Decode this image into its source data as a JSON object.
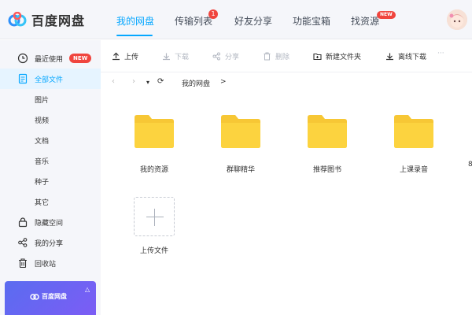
{
  "app": {
    "name": "百度网盘"
  },
  "nav": {
    "tabs": [
      {
        "label": "我的网盘",
        "active": true
      },
      {
        "label": "传输列表",
        "badge": "1"
      },
      {
        "label": "好友分享"
      },
      {
        "label": "功能宝箱"
      },
      {
        "label": "找资源",
        "badge": "NEW"
      }
    ]
  },
  "sidebar": {
    "items": [
      {
        "label": "最近使用",
        "icon": "clock-icon",
        "badge": "NEW"
      },
      {
        "label": "全部文件",
        "icon": "document-icon",
        "active": true
      },
      {
        "label": "图片"
      },
      {
        "label": "视频"
      },
      {
        "label": "文档"
      },
      {
        "label": "音乐"
      },
      {
        "label": "种子"
      },
      {
        "label": "其它"
      },
      {
        "label": "隐藏空间",
        "icon": "lock-icon"
      },
      {
        "label": "我的分享",
        "icon": "share-icon"
      },
      {
        "label": "回收站",
        "icon": "trash-icon"
      }
    ],
    "promo": {
      "logo_text": "百度网盘",
      "close": "△"
    }
  },
  "toolbar": {
    "upload": "上传",
    "download": "下载",
    "share": "分享",
    "delete": "删除",
    "new_folder": "新建文件夹",
    "offline_download": "离线下载",
    "more": "···"
  },
  "path": {
    "back": "‹",
    "forward": "›",
    "dropdown": "▾",
    "refresh": "⟳",
    "crumb": "我的网盘",
    "separator": ">"
  },
  "files": [
    {
      "name": "我的资源",
      "type": "folder"
    },
    {
      "name": "群聊精华",
      "type": "folder"
    },
    {
      "name": "推荐图书",
      "type": "folder"
    },
    {
      "name": "上课录音",
      "type": "folder"
    }
  ],
  "upload_tile": {
    "label": "上传文件"
  },
  "overflow_char": "8",
  "colors": {
    "accent": "#06a7ff",
    "folder": "#f7c735",
    "badge": "#f0453e"
  }
}
